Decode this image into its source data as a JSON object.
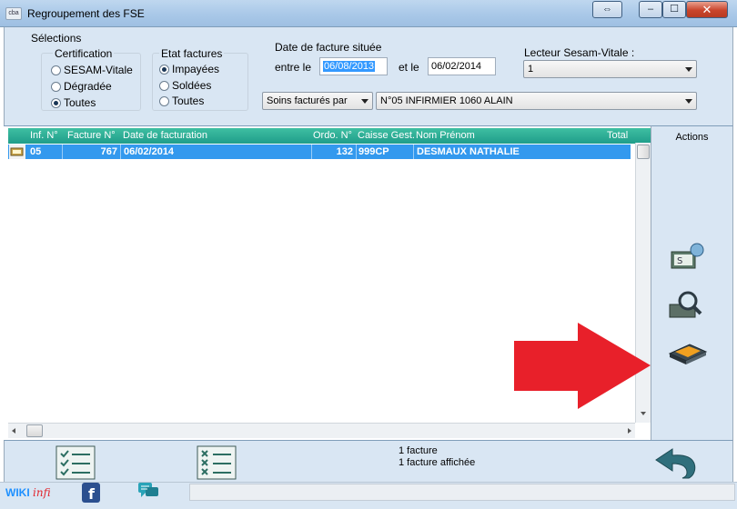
{
  "window": {
    "title": "Regroupement des FSE",
    "app_icon_text": "cba",
    "controls": {
      "swap": "⇔",
      "minimize": "–",
      "maximize": "☐",
      "close": "✕"
    }
  },
  "selections": {
    "title": "Sélections",
    "certification": {
      "title": "Certification",
      "options": [
        "SESAM-Vitale",
        "Dégradée",
        "Toutes"
      ],
      "selected": "Toutes"
    },
    "etat": {
      "title": "Etat factures",
      "options": [
        "Impayées",
        "Soldées",
        "Toutes"
      ],
      "selected": "Impayées"
    },
    "date": {
      "title": "Date de facture située",
      "from_label": "entre le",
      "from_value": "06/08/2013",
      "to_label": "et le",
      "to_value": "06/02/2014"
    },
    "lecteur": {
      "title": "Lecteur Sesam-Vitale :",
      "value": "1"
    },
    "soins": {
      "value": "Soins facturés par"
    },
    "infirmier": {
      "value": "N°05  INFIRMIER 1060 ALAIN"
    }
  },
  "grid": {
    "columns": [
      "Inf. N°",
      "Facture N°",
      "Date de facturation",
      "Ordo. N°",
      "Caisse Gest.",
      "Nom Prénom",
      "Total"
    ],
    "rows": [
      {
        "inf": "05",
        "facture": "767",
        "date": "06/02/2014",
        "ordo": "132",
        "caisse": "999CP",
        "nom": "DESMAUX NATHALIE"
      }
    ]
  },
  "actions": {
    "title": "Actions"
  },
  "summary": {
    "count": "1 facture",
    "shown": "1 facture affichée"
  },
  "status": {
    "wiki": "WIKI",
    "wiki_accent": "infi"
  },
  "colors": {
    "accent_grid_header": "#1f9d8a",
    "row_selected": "#3399ee",
    "arrow": "#e8202a"
  }
}
